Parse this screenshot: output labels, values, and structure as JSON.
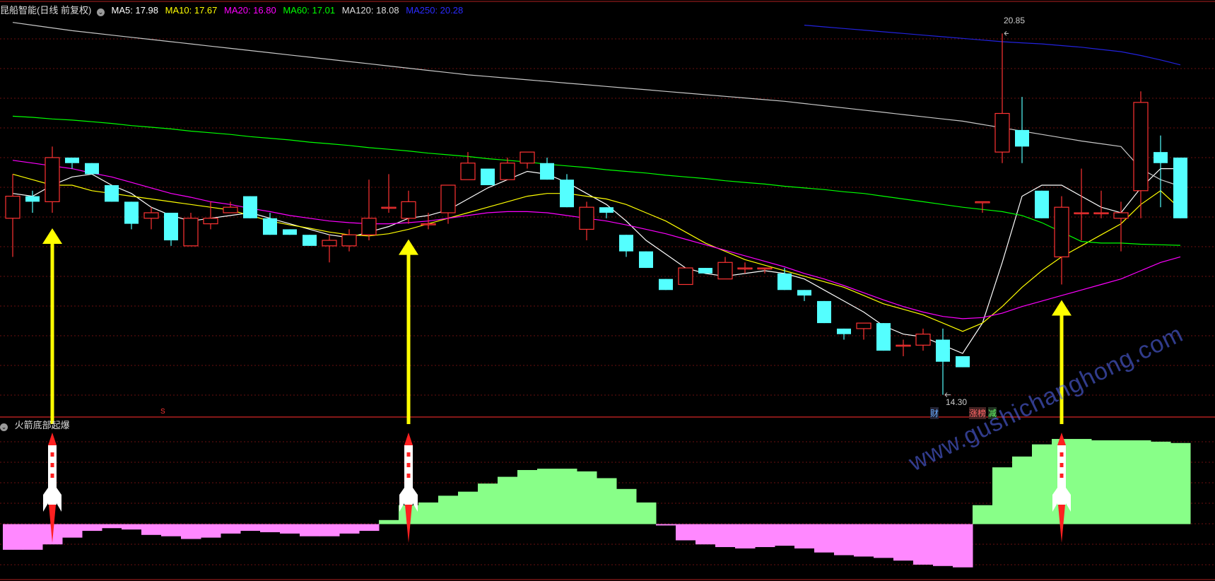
{
  "header": {
    "stock_name": "昆船智能(日线 前复权)",
    "ma": [
      {
        "label": "MA5: 17.98",
        "color": "#ffffff"
      },
      {
        "label": "MA10: 17.67",
        "color": "#ffff00"
      },
      {
        "label": "MA20: 16.80",
        "color": "#ff00ff"
      },
      {
        "label": "MA60: 17.01",
        "color": "#00ff00"
      },
      {
        "label": "MA120: 18.08",
        "color": "#dddddd"
      },
      {
        "label": "MA250: 20.28",
        "color": "#2b2bff"
      }
    ]
  },
  "indicator": {
    "name": "火箭底部起爆"
  },
  "annotations": {
    "high": "20.85",
    "low": "14.30",
    "s_marker": "S",
    "badge_cai": "财",
    "badge_zhangbang": "涨榜",
    "badge_jian": "减"
  },
  "watermark": "www.gushichanghong.com",
  "chart_data": {
    "type": "candlestick",
    "up_color": "#ff3333",
    "down_color": "#54ffff",
    "ylim": [
      14.0,
      21.2
    ],
    "candles": [
      [
        17.5,
        18.3,
        16.8,
        17.9
      ],
      [
        17.9,
        18.0,
        17.6,
        17.8
      ],
      [
        17.8,
        18.8,
        17.6,
        18.6
      ],
      [
        18.6,
        18.5,
        18.4,
        18.5
      ],
      [
        18.5,
        18.5,
        18.3,
        18.3
      ],
      [
        18.1,
        18.1,
        17.8,
        17.8
      ],
      [
        17.8,
        17.8,
        17.3,
        17.4
      ],
      [
        17.5,
        17.7,
        17.3,
        17.6
      ],
      [
        17.6,
        17.6,
        17.0,
        17.1
      ],
      [
        17.0,
        17.6,
        17.0,
        17.5
      ],
      [
        17.4,
        17.8,
        17.3,
        17.5
      ],
      [
        17.6,
        17.8,
        17.6,
        17.7
      ],
      [
        17.9,
        17.9,
        17.5,
        17.5
      ],
      [
        17.5,
        17.6,
        17.2,
        17.2
      ],
      [
        17.3,
        17.3,
        17.2,
        17.2
      ],
      [
        17.2,
        17.2,
        17.0,
        17.0
      ],
      [
        17.0,
        17.2,
        16.7,
        17.1
      ],
      [
        17.0,
        17.3,
        16.9,
        17.2
      ],
      [
        17.2,
        18.2,
        17.1,
        17.5
      ],
      [
        17.7,
        18.3,
        17.6,
        17.7
      ],
      [
        17.5,
        18.0,
        17.4,
        17.8
      ],
      [
        17.4,
        17.6,
        17.3,
        17.4
      ],
      [
        17.6,
        18.1,
        17.4,
        18.1
      ],
      [
        18.2,
        18.7,
        18.2,
        18.5
      ],
      [
        18.4,
        18.3,
        18.1,
        18.1
      ],
      [
        18.2,
        18.6,
        18.2,
        18.5
      ],
      [
        18.5,
        18.7,
        18.4,
        18.7
      ],
      [
        18.5,
        18.6,
        18.2,
        18.2
      ],
      [
        18.2,
        18.3,
        17.7,
        17.7
      ],
      [
        17.3,
        17.8,
        17.1,
        17.7
      ],
      [
        17.7,
        17.7,
        17.5,
        17.6
      ],
      [
        17.2,
        17.2,
        16.8,
        16.9
      ],
      [
        16.9,
        16.9,
        16.6,
        16.6
      ],
      [
        16.4,
        16.4,
        16.2,
        16.2
      ],
      [
        16.3,
        16.6,
        16.3,
        16.6
      ],
      [
        16.6,
        16.6,
        16.5,
        16.5
      ],
      [
        16.4,
        16.8,
        16.4,
        16.7
      ],
      [
        16.6,
        16.7,
        16.5,
        16.6
      ],
      [
        16.6,
        16.6,
        16.5,
        16.6
      ],
      [
        16.5,
        16.6,
        16.2,
        16.2
      ],
      [
        16.2,
        16.2,
        16.0,
        16.1
      ],
      [
        16.0,
        16.0,
        15.6,
        15.6
      ],
      [
        15.5,
        15.5,
        15.3,
        15.4
      ],
      [
        15.5,
        15.6,
        15.3,
        15.6
      ],
      [
        15.6,
        15.6,
        15.1,
        15.1
      ],
      [
        15.2,
        15.3,
        15.0,
        15.2
      ],
      [
        15.2,
        15.5,
        15.1,
        15.4
      ],
      [
        15.3,
        15.5,
        14.3,
        14.9
      ],
      [
        15.0,
        15.0,
        14.8,
        14.8
      ],
      [
        17.8,
        17.8,
        17.6,
        17.8
      ],
      [
        18.7,
        20.85,
        18.5,
        19.4
      ],
      [
        19.1,
        19.7,
        18.5,
        18.8
      ],
      [
        18.0,
        18.0,
        17.5,
        17.5
      ],
      [
        16.8,
        17.9,
        16.3,
        17.7
      ],
      [
        17.6,
        18.4,
        17.1,
        17.6
      ],
      [
        17.6,
        18.0,
        17.5,
        17.6
      ],
      [
        17.5,
        17.8,
        16.9,
        17.6
      ],
      [
        18.0,
        19.8,
        17.5,
        19.6
      ],
      [
        18.7,
        19.0,
        17.7,
        18.5
      ],
      [
        18.6,
        18.5,
        17.5,
        17.5
      ]
    ],
    "ma_lines": [
      {
        "name": "MA5",
        "color": "#ffffff",
        "values": [
          17.95,
          17.9,
          18.1,
          18.25,
          18.3,
          18.1,
          17.95,
          17.7,
          17.55,
          17.45,
          17.5,
          17.55,
          17.6,
          17.5,
          17.4,
          17.3,
          17.2,
          17.15,
          17.25,
          17.35,
          17.5,
          17.55,
          17.65,
          17.85,
          18.05,
          18.2,
          18.35,
          18.3,
          18.15,
          17.95,
          17.75,
          17.45,
          17.1,
          16.85,
          16.6,
          16.5,
          16.45,
          16.5,
          16.55,
          16.5,
          16.4,
          16.2,
          16.0,
          15.8,
          15.55,
          15.4,
          15.35,
          15.2,
          15.05,
          15.6,
          16.7,
          17.9,
          18.1,
          18.1,
          17.9,
          17.7,
          17.6,
          18.05,
          18.4,
          18.4
        ]
      },
      {
        "name": "MA10",
        "color": "#ffff00",
        "values": [
          18.3,
          18.2,
          18.1,
          18.1,
          18.0,
          17.95,
          17.9,
          17.85,
          17.8,
          17.75,
          17.7,
          17.65,
          17.55,
          17.45,
          17.38,
          17.32,
          17.25,
          17.2,
          17.18,
          17.22,
          17.3,
          17.4,
          17.5,
          17.6,
          17.7,
          17.8,
          17.9,
          17.95,
          17.95,
          17.9,
          17.85,
          17.75,
          17.6,
          17.45,
          17.25,
          17.05,
          16.9,
          16.75,
          16.65,
          16.55,
          16.45,
          16.35,
          16.25,
          16.1,
          15.95,
          15.85,
          15.75,
          15.6,
          15.45,
          15.6,
          15.9,
          16.25,
          16.55,
          16.8,
          17.0,
          17.2,
          17.4,
          17.75,
          18.0,
          17.67
        ]
      },
      {
        "name": "MA20",
        "color": "#ff00ff",
        "values": [
          18.55,
          18.5,
          18.45,
          18.4,
          18.32,
          18.25,
          18.15,
          18.05,
          17.95,
          17.88,
          17.8,
          17.75,
          17.68,
          17.62,
          17.55,
          17.5,
          17.45,
          17.42,
          17.4,
          17.4,
          17.42,
          17.45,
          17.5,
          17.55,
          17.6,
          17.62,
          17.62,
          17.6,
          17.55,
          17.5,
          17.45,
          17.38,
          17.3,
          17.22,
          17.12,
          17.02,
          16.92,
          16.82,
          16.72,
          16.62,
          16.5,
          16.4,
          16.28,
          16.15,
          16.02,
          15.9,
          15.8,
          15.72,
          15.68,
          15.7,
          15.78,
          15.9,
          16.0,
          16.1,
          16.2,
          16.3,
          16.4,
          16.55,
          16.7,
          16.8
        ]
      },
      {
        "name": "MA60",
        "color": "#00ff00",
        "values": [
          19.35,
          19.33,
          19.3,
          19.28,
          19.25,
          19.22,
          19.18,
          19.15,
          19.12,
          19.08,
          19.05,
          19.02,
          18.98,
          18.95,
          18.92,
          18.88,
          18.85,
          18.82,
          18.78,
          18.75,
          18.72,
          18.68,
          18.65,
          18.62,
          18.58,
          18.55,
          18.52,
          18.48,
          18.45,
          18.42,
          18.38,
          18.35,
          18.32,
          18.28,
          18.25,
          18.22,
          18.18,
          18.15,
          18.12,
          18.08,
          18.05,
          18.02,
          17.98,
          17.95,
          17.9,
          17.85,
          17.8,
          17.75,
          17.7,
          17.66,
          17.62,
          17.55,
          17.42,
          17.25,
          17.08,
          17.05,
          17.05,
          17.03,
          17.02,
          17.01
        ]
      },
      {
        "name": "MA120",
        "color": "#c8c8c8",
        "values": [
          21.05,
          21.0,
          20.95,
          20.9,
          20.86,
          20.82,
          20.78,
          20.74,
          20.7,
          20.66,
          20.62,
          20.58,
          20.54,
          20.5,
          20.46,
          20.42,
          20.38,
          20.34,
          20.3,
          20.26,
          20.22,
          20.18,
          20.14,
          20.1,
          20.07,
          20.04,
          20.01,
          19.98,
          19.95,
          19.92,
          19.89,
          19.86,
          19.83,
          19.8,
          19.77,
          19.74,
          19.71,
          19.68,
          19.65,
          19.62,
          19.58,
          19.54,
          19.5,
          19.46,
          19.42,
          19.38,
          19.34,
          19.3,
          19.26,
          19.2,
          19.14,
          19.08,
          19.02,
          18.96,
          18.9,
          18.85,
          18.8,
          18.4,
          18.2,
          18.08
        ]
      },
      {
        "name": "MA250",
        "color": "#2222dd",
        "values": [
          null,
          null,
          null,
          null,
          null,
          null,
          null,
          null,
          null,
          null,
          null,
          null,
          null,
          null,
          null,
          null,
          null,
          null,
          null,
          null,
          null,
          null,
          null,
          null,
          null,
          null,
          null,
          null,
          null,
          null,
          null,
          null,
          null,
          null,
          null,
          null,
          null,
          null,
          null,
          null,
          21.0,
          20.97,
          20.94,
          20.91,
          20.88,
          20.85,
          20.82,
          20.79,
          20.76,
          20.73,
          20.7,
          20.68,
          20.66,
          20.63,
          20.6,
          20.56,
          20.52,
          20.45,
          20.37,
          20.28
        ]
      }
    ],
    "indicator_bars": [
      -0.95,
      -0.95,
      -0.75,
      -0.5,
      -0.25,
      -0.15,
      -0.2,
      -0.4,
      -0.45,
      -0.55,
      -0.5,
      -0.35,
      -0.25,
      -0.3,
      -0.35,
      -0.45,
      -0.45,
      -0.35,
      -0.25,
      0.15,
      0.7,
      0.8,
      1.05,
      1.2,
      1.5,
      1.75,
      2.0,
      2.05,
      2.05,
      1.95,
      1.7,
      1.3,
      0.8,
      -0.05,
      -0.6,
      -0.75,
      -0.85,
      -0.9,
      -0.85,
      -0.8,
      -0.9,
      -1.05,
      -1.15,
      -1.2,
      -1.25,
      -1.35,
      -1.5,
      -1.55,
      -1.6,
      0.7,
      2.1,
      2.5,
      2.95,
      3.15,
      3.15,
      3.1,
      3.1,
      3.1,
      3.05,
      3.0
    ],
    "indicator_ylim": [
      -2.0,
      3.7
    ],
    "positive_color": "#88ff88",
    "negative_color": "#ff88ff",
    "signals": [
      2,
      20,
      53
    ]
  }
}
